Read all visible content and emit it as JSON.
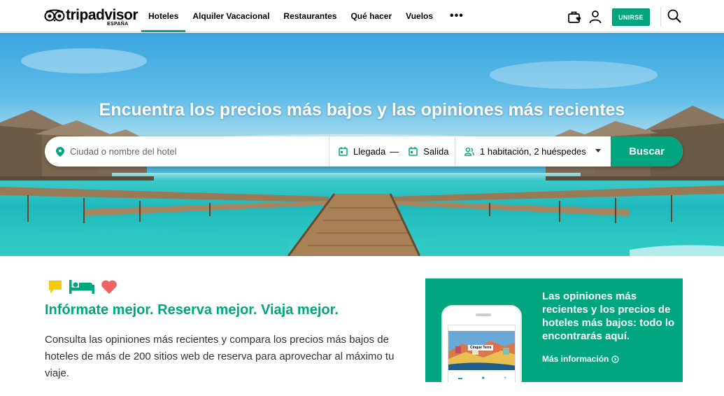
{
  "header": {
    "logo_text": "tripadvisor",
    "logo_sub": "ESPAÑA",
    "nav": [
      {
        "label": "Hoteles",
        "active": true
      },
      {
        "label": "Alquiler Vacacional",
        "active": false
      },
      {
        "label": "Restaurantes",
        "active": false
      },
      {
        "label": "Qué hacer",
        "active": false
      },
      {
        "label": "Vuelos",
        "active": false
      }
    ],
    "more_label": "•••",
    "join_label": "UNIRSE",
    "icons": {
      "trips": "suitcase-heart-icon",
      "profile": "user-icon",
      "search": "search-icon"
    }
  },
  "hero": {
    "title": "Encuentra los precios más bajos y las opiniones más recientes",
    "search": {
      "city_placeholder": "Ciudad o nombre del hotel",
      "checkin_label": "Llegada",
      "separator": "—",
      "checkout_label": "Salida",
      "guests_label": "1 habitación, 2 huéspedes",
      "button_label": "Buscar"
    }
  },
  "content": {
    "tagline": "Infórmate mejor. Reserva mejor. Viaja mejor.",
    "description": "Consulta las opiniones más recientes y compara los precios más bajos de hoteles de más de 200 sitios web de reserva para aprovechar al máximo tu viaje.",
    "icons": [
      "speech-bubble-icon",
      "bed-icon",
      "heart-icon"
    ]
  },
  "promo": {
    "title": "Las opiniones más recientes y los precios de hoteles más bajos: todo lo encontrarás aquí.",
    "link_label": "Más información",
    "phone_tag": "Cinque Terre"
  },
  "colors": {
    "brand": "#00a680",
    "speech_bubble": "#f2c90c",
    "heart": "#ef6262"
  }
}
